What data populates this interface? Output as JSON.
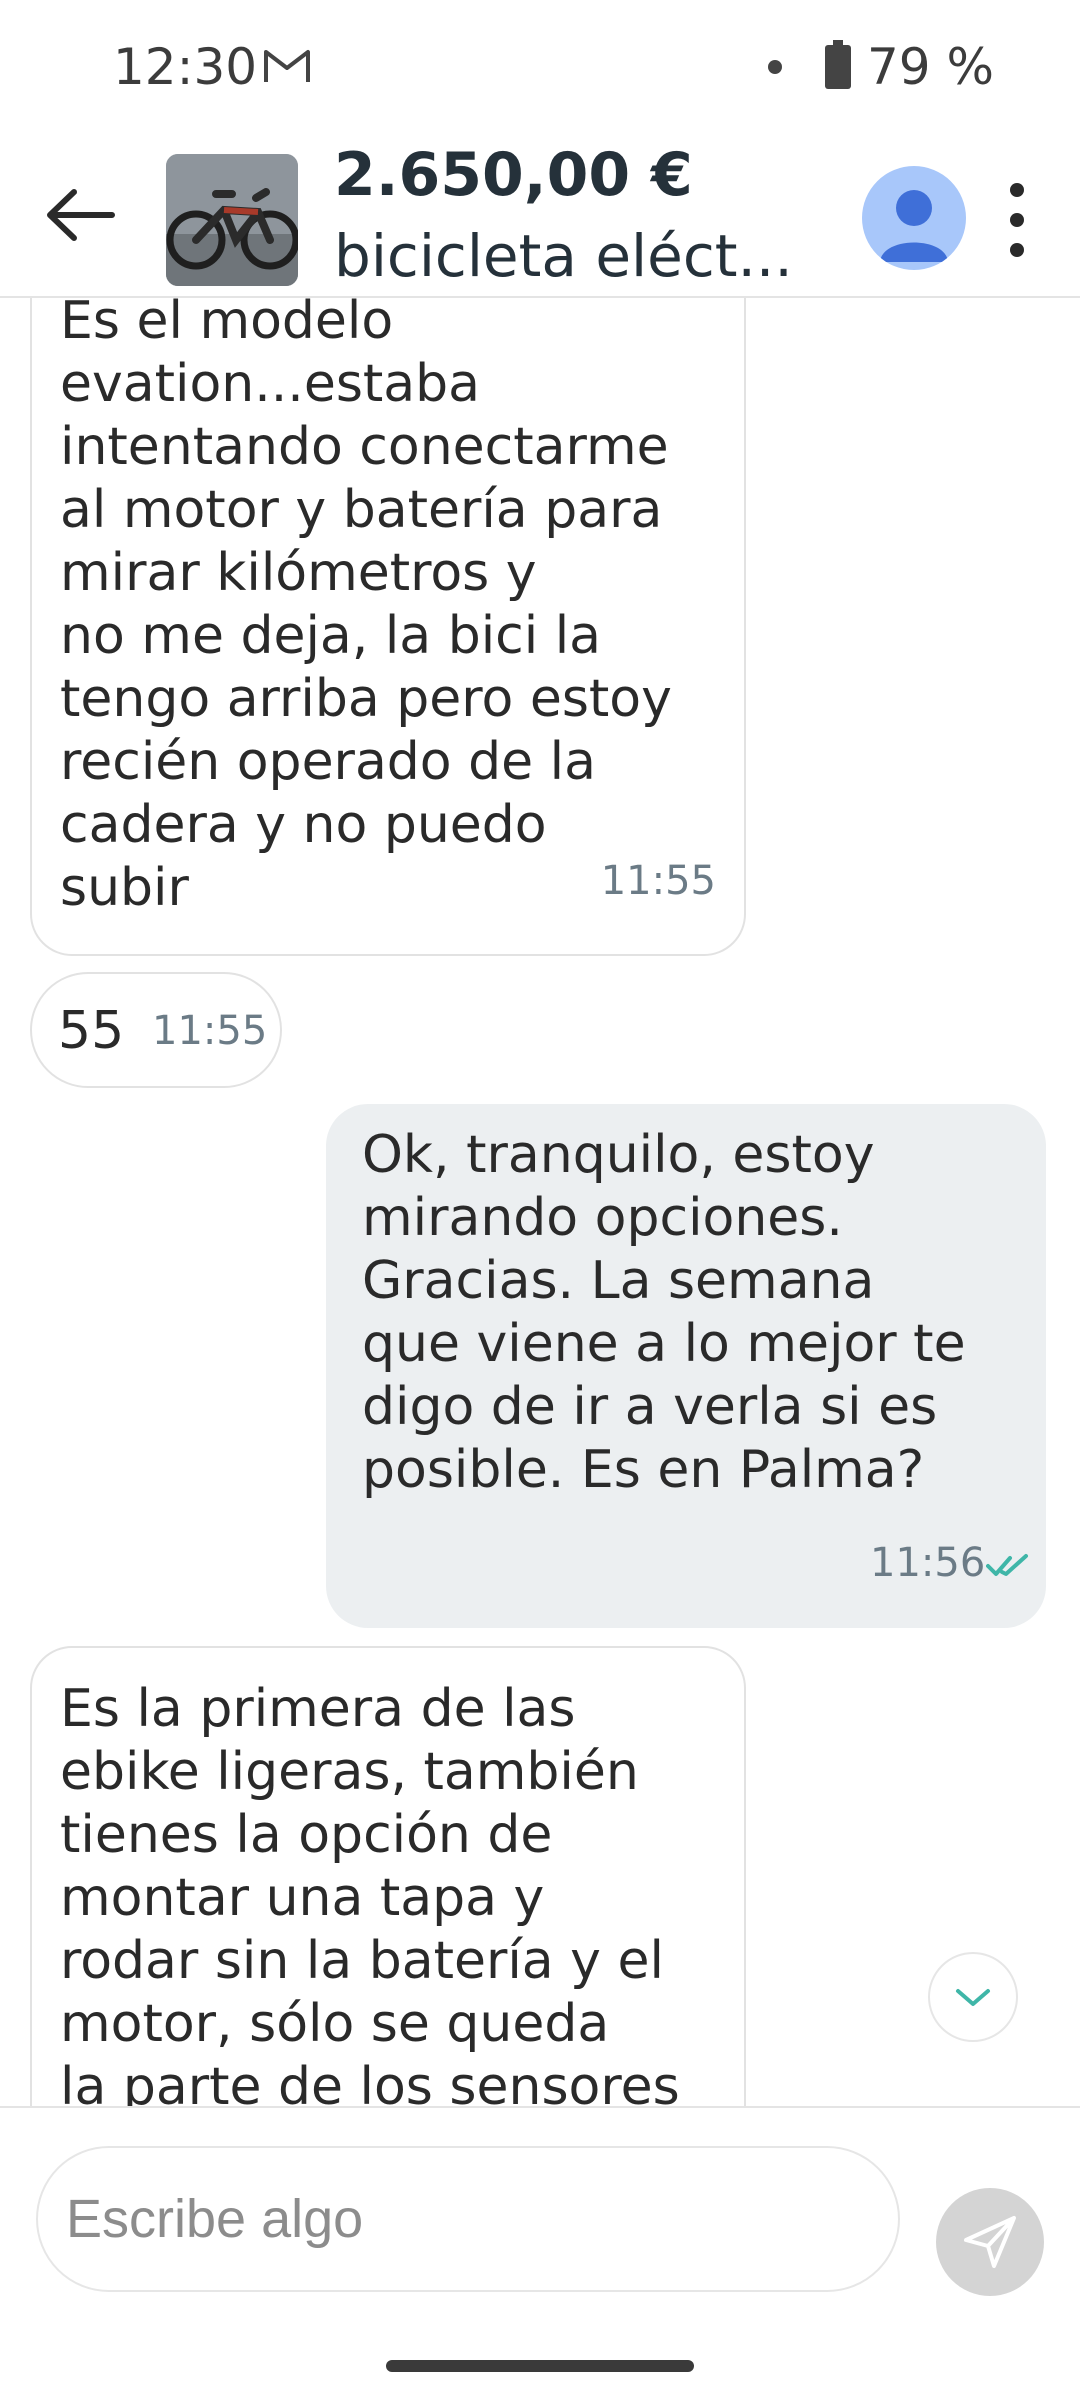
{
  "status_bar": {
    "time": "12:30",
    "battery": "79 %"
  },
  "header": {
    "price": "2.650,00 €",
    "title": "bicicleta  eléct..."
  },
  "messages": [
    {
      "direction": "incoming",
      "text": "Es el modelo\nevation...estaba\nintentando conectarme\nal motor y batería para\nmirar kilómetros y\nno me deja, la bici la\ntengo arriba pero estoy\nrecién operado de la\ncadera y no puedo\nsubir",
      "time": "11:55"
    },
    {
      "direction": "incoming",
      "text": "55",
      "time": "11:55"
    },
    {
      "direction": "outgoing",
      "text": "Ok, tranquilo, estoy\nmirando opciones.\nGracias. La semana\nque viene a lo mejor te\ndigo de ir a verla si es\nposible. Es en Palma?",
      "time": "11:56",
      "status": "read"
    },
    {
      "direction": "incoming",
      "text": "Es la primera de las\nebike ligeras, también\ntienes la opción de\nmontar una tapa y\nrodar sin la batería y el\nmotor, sólo se queda\nla parte de los sensores",
      "time": ""
    }
  ],
  "composer": {
    "placeholder": "Escribe algo"
  },
  "colors": {
    "accent_check": "#3fb6a8",
    "outgoing_bubble": "#eceff1",
    "avatar": "#a8c7fa"
  }
}
